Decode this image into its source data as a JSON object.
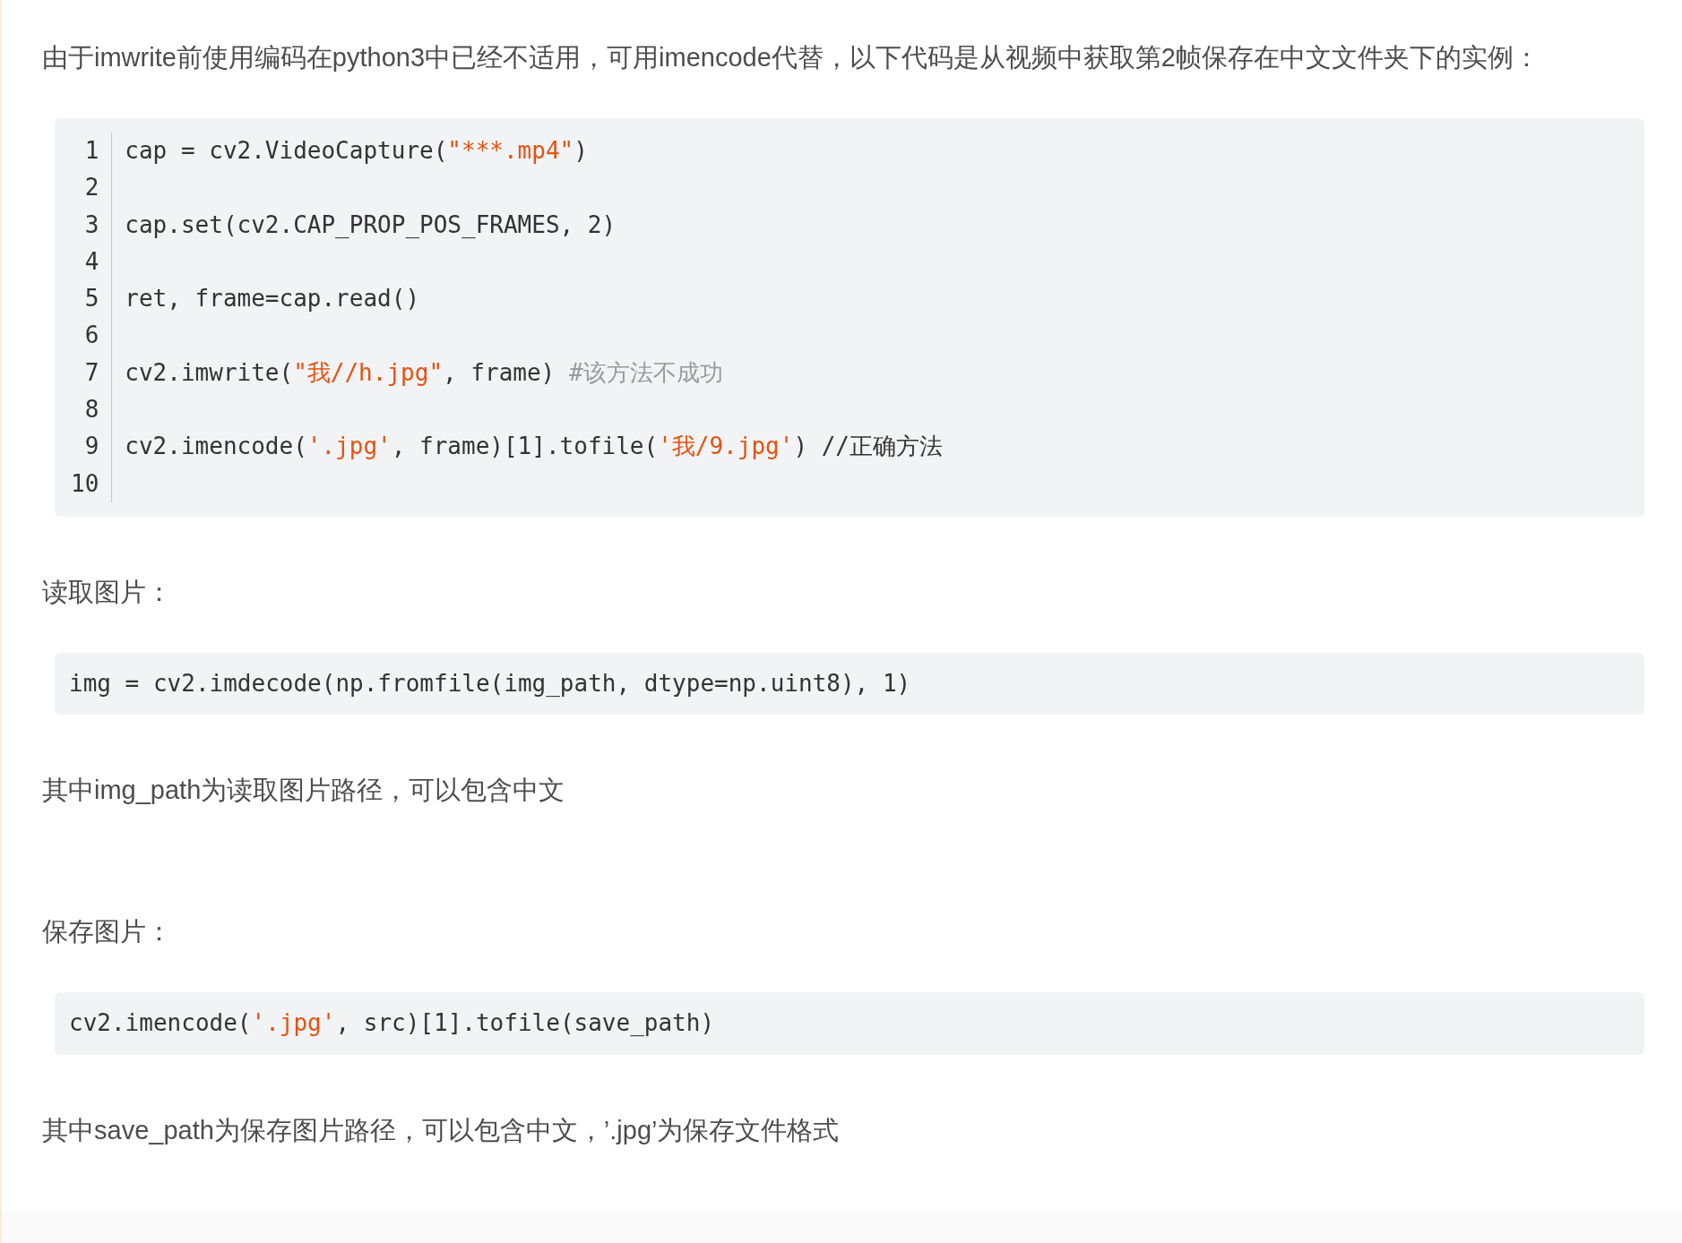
{
  "blocks": [
    {
      "kind": "paragraph",
      "text": "由于imwrite前使用编码在python3中已经不适用，可用imencode代替，以下代码是从视频中获取第2帧保存在中文文件夹下的实例："
    },
    {
      "kind": "numbered_code",
      "lines": [
        {
          "number": "1",
          "tokens": [
            {
              "kind": "plain",
              "text": "cap = cv2.VideoCapture("
            },
            {
              "kind": "string",
              "text": "\"***.mp4\""
            },
            {
              "kind": "plain",
              "text": ")"
            }
          ]
        },
        {
          "number": "2"
        },
        {
          "number": "3",
          "tokens": [
            {
              "kind": "plain",
              "text": "cap.set(cv2.CAP_PROP_POS_FRAMES, 2)"
            }
          ]
        },
        {
          "number": "4"
        },
        {
          "number": "5",
          "tokens": [
            {
              "kind": "plain",
              "text": "ret, frame=cap.read()"
            }
          ]
        },
        {
          "number": "6"
        },
        {
          "number": "7",
          "tokens": [
            {
              "kind": "plain",
              "text": "cv2.imwrite("
            },
            {
              "kind": "string",
              "text": "\"我//h.jpg\""
            },
            {
              "kind": "plain",
              "text": ", frame) "
            },
            {
              "kind": "comment",
              "text": "#该方法不成功"
            }
          ]
        },
        {
          "number": "8"
        },
        {
          "number": "9",
          "tokens": [
            {
              "kind": "plain",
              "text": "cv2.imencode("
            },
            {
              "kind": "string",
              "text": "'.jpg'"
            },
            {
              "kind": "plain",
              "text": ", frame)[1].tofile("
            },
            {
              "kind": "string",
              "text": "'我/9.jpg'"
            },
            {
              "kind": "plain",
              "text": ") //正确方法"
            }
          ]
        },
        {
          "number": "10"
        }
      ]
    },
    {
      "kind": "paragraph",
      "text": "读取图片："
    },
    {
      "kind": "code",
      "tokens": [
        {
          "kind": "plain",
          "text": "img = cv2.imdecode(np.fromfile(img_path, dtype=np.uint8), 1)"
        }
      ]
    },
    {
      "kind": "paragraph",
      "text": "其中img_path为读取图片路径，可以包含中文"
    },
    {
      "kind": "spacer"
    },
    {
      "kind": "paragraph",
      "text": "保存图片："
    },
    {
      "kind": "code",
      "tokens": [
        {
          "kind": "plain",
          "text": "cv2.imencode("
        },
        {
          "kind": "string",
          "text": "'.jpg'"
        },
        {
          "kind": "plain",
          "text": ", src)[1].tofile(save_path)"
        }
      ]
    },
    {
      "kind": "paragraph",
      "text": "其中save_path为保存图片路径，可以包含中文，’.jpg’为保存文件格式"
    }
  ]
}
